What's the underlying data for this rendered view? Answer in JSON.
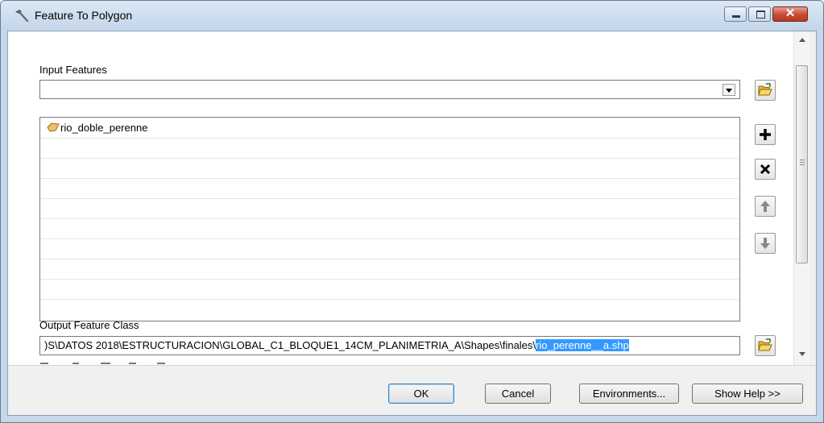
{
  "window": {
    "title": "Feature To Polygon",
    "close_glyph": "✕",
    "icons": [
      "hammer-icon",
      "minimize-icon",
      "maximize-icon",
      "close-icon"
    ]
  },
  "input_features": {
    "label": "Input Features",
    "value": "",
    "items": [
      {
        "name": "rio_doble_perenne",
        "icon": "polygon-layer-icon",
        "icon_color": "#f0c060"
      }
    ]
  },
  "side_buttons": [
    "folder-open-icon",
    "add-icon",
    "remove-icon",
    "move-up-icon",
    "move-down-icon"
  ],
  "output_feature_class": {
    "label": "Output Feature Class",
    "path_prefix": ")S\\DATOS 2018\\ESTRUCTURACION\\GLOBAL_C1_BLOQUE1_14CM_PLANIMETRIA_A\\Shapes\\finales\\",
    "path_selected": "rio_perenne__a.shp"
  },
  "buttons": {
    "ok": "OK",
    "cancel": "Cancel",
    "environments": "Environments...",
    "show_help": "Show Help >>"
  },
  "colors": {
    "selection": "#3399ff",
    "title_bar": "#c6d8ec",
    "close_button": "#c54a31"
  }
}
